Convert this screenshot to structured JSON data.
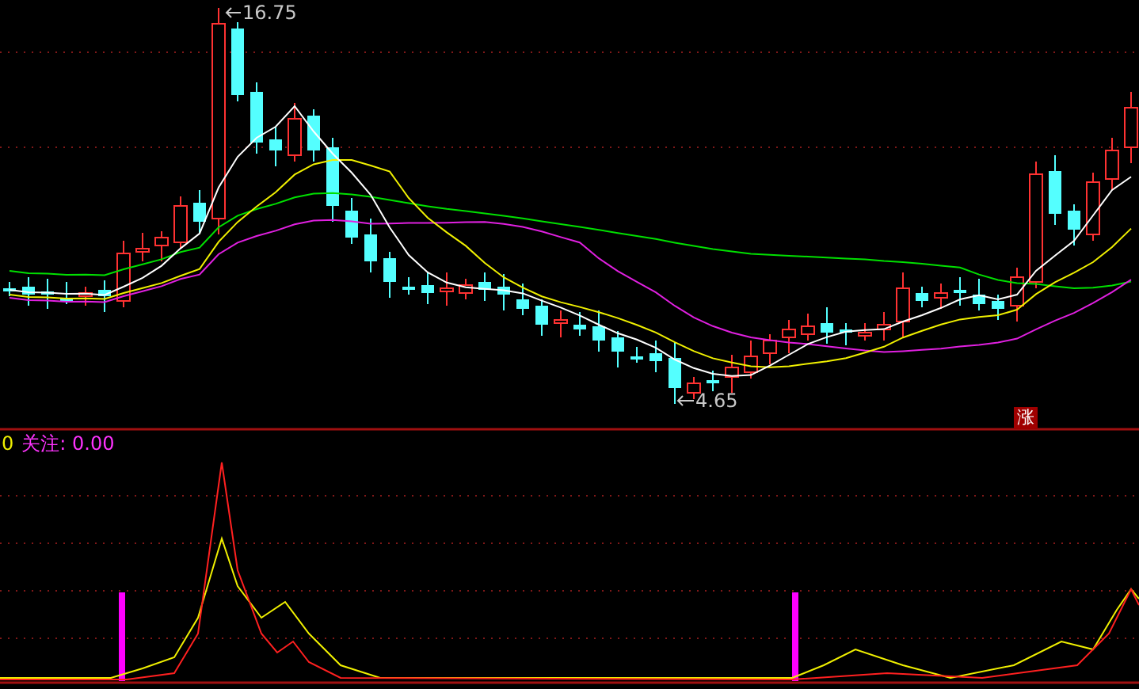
{
  "price_chart": {
    "high_label": "16.75",
    "low_label": "4.65",
    "badge": "涨"
  },
  "indicator": {
    "value": "0",
    "name_reading": "关注: 0.00"
  }
}
